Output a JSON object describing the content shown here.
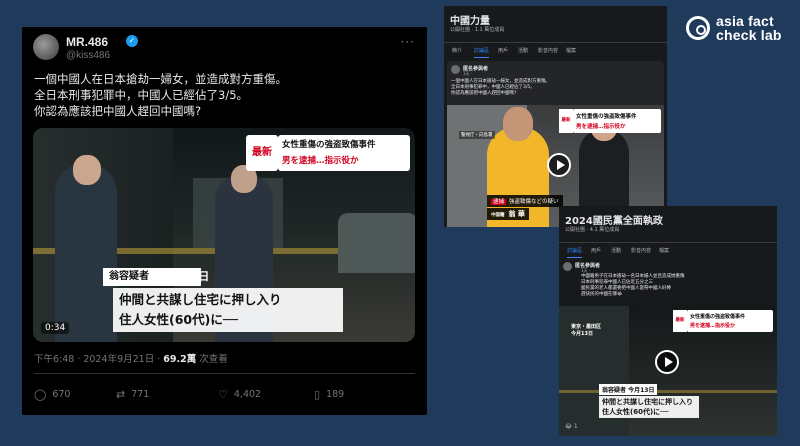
{
  "logo": {
    "line1": "asia fact",
    "line2": "check lab"
  },
  "tweet": {
    "author_name": "MR.486",
    "handle": "@kiss486",
    "more": "···",
    "text_lines": [
      "一個中國人在日本搶劫一婦女，並造成對方重傷。",
      "全日本刑事犯罪中，中國人已經佔了3/5。",
      "你認為應該把中國人趕回中國嗎?"
    ],
    "video": {
      "badge_new": "最新",
      "headline_1": "女性重傷の強盗致傷事件",
      "headline_2": "男を逮捕…指示役か",
      "suspect_label": "翁容疑者",
      "date": "今月13日",
      "caption_1": "仲間と共謀し住宅に押し入り",
      "caption_2": "住人女性(60代)に──",
      "duration": "0:34"
    },
    "meta_time": "下午6:48 · 2024年9月21日 · ",
    "meta_views": "69.2萬",
    "meta_views_label": " 次查看",
    "replies": "670",
    "retweets": "771",
    "likes": "4,402",
    "bookmarks": "189"
  },
  "fb1": {
    "title": "中國力量",
    "subtitle": "公開社團 · 1.1 萬位成員",
    "tabs": [
      "簡介",
      "討論區",
      "用戶",
      "活動",
      "影音內容",
      "檔案"
    ],
    "post_author": "匿名參與者",
    "post_time": "1天 · ",
    "post_lines": [
      "一個中國人在日本搶劫一婦女，並造成對方重傷。",
      "全日本刑事犯罪中，中國人已經佔了3/5。",
      "你認為應該把中國人趕回中國嗎?"
    ],
    "video": {
      "badge_new": "最新",
      "headline_1": "女性重傷の強盗致傷事件",
      "headline_2": "男を逮捕…指示役か",
      "location": "警視庁・向島署",
      "tag": "逮捕",
      "caption": "強盗致傷などの疑い",
      "nationality": "中国籍",
      "name": "翁 華"
    }
  },
  "fb2": {
    "title": "2024國民黨全面執政",
    "subtitle": "公開社團 · 4.1 萬位成員",
    "tabs": [
      "討論區",
      "用戶",
      "活動",
      "影音內容",
      "檔案"
    ],
    "post_author": "匿名參與者",
    "post_time": "1天 · ",
    "post_lines": [
      "中國籍男子在日本搶劫一名日本婦人並且造成她重傷",
      "日本刑事犯罪中國人已佔近五分之三",
      "國民黨的老人都還要把中國人當帶中國人好棒",
      "趕快民的中國在哪😂"
    ],
    "video": {
      "badge_new": "最新",
      "headline_1": "女性重傷の強盗致傷事件",
      "headline_2": "男を逮捕…指示役か",
      "location": "東京・墨田区",
      "date_top": "今月13日",
      "suspect_label": "翁容疑者",
      "date": "今月13日",
      "caption_1": "仲間と共謀し住宅に押し入り",
      "caption_2": "住人女性(60代)に──"
    },
    "footer": "😂 1"
  }
}
